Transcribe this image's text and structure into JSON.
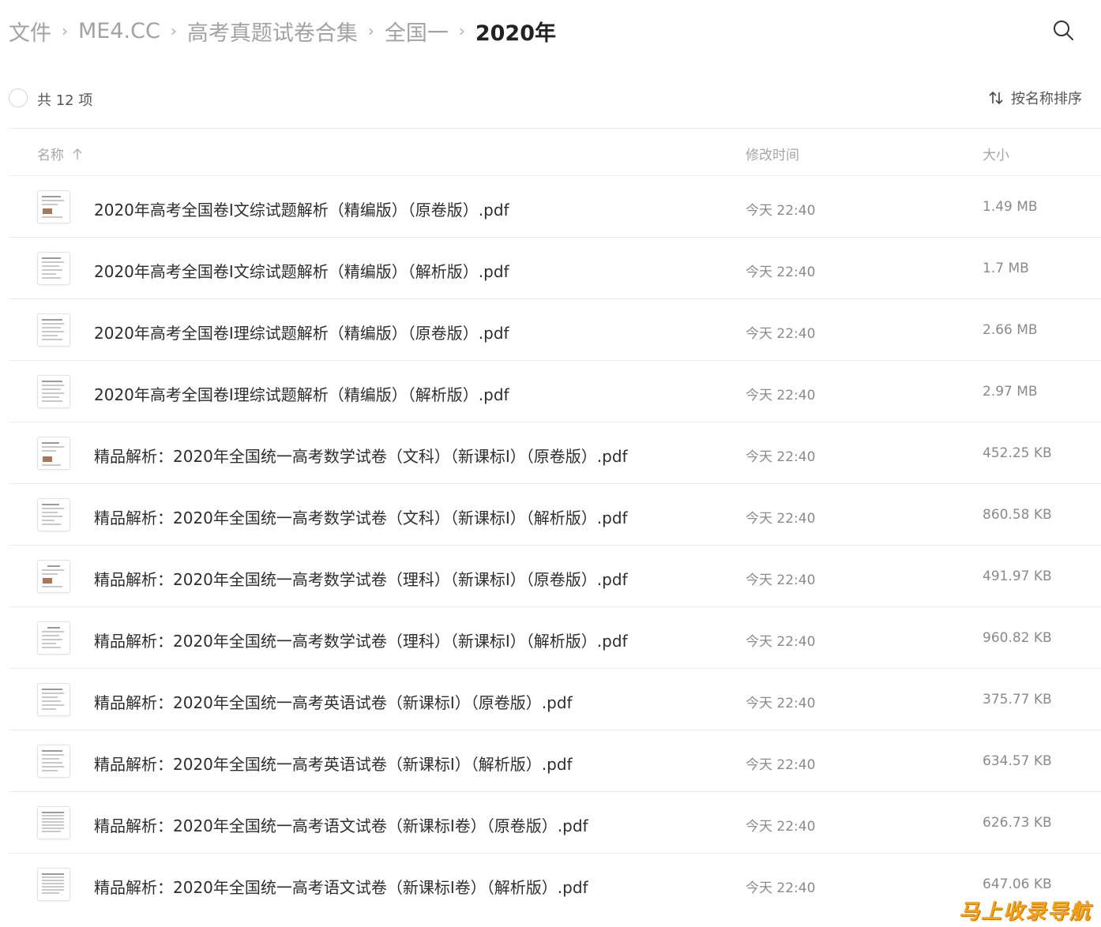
{
  "breadcrumb": {
    "items": [
      "文件",
      "ME4.CC",
      "高考真题试卷合集",
      "全国一",
      "2020年"
    ],
    "separator": "›"
  },
  "toolbar": {
    "count_label": "共 12 项",
    "sort_label": "按名称排序"
  },
  "columns": {
    "name": "名称",
    "mtime": "修改时间",
    "size": "大小"
  },
  "files": [
    {
      "name": "2020年高考全国卷Ⅰ文综试题解析（精编版）（原卷版）.pdf",
      "mtime": "今天 22:40",
      "size": "1.49 MB"
    },
    {
      "name": "2020年高考全国卷Ⅰ文综试题解析（精编版）（解析版）.pdf",
      "mtime": "今天 22:40",
      "size": "1.7 MB"
    },
    {
      "name": "2020年高考全国卷Ⅰ理综试题解析（精编版）（原卷版）.pdf",
      "mtime": "今天 22:40",
      "size": "2.66 MB"
    },
    {
      "name": "2020年高考全国卷Ⅰ理综试题解析（精编版）（解析版）.pdf",
      "mtime": "今天 22:40",
      "size": "2.97 MB"
    },
    {
      "name": "精品解析：2020年全国统一高考数学试卷（文科）（新课标Ⅰ）（原卷版）.pdf",
      "mtime": "今天 22:40",
      "size": "452.25 KB"
    },
    {
      "name": "精品解析：2020年全国统一高考数学试卷（文科）（新课标Ⅰ）（解析版）.pdf",
      "mtime": "今天 22:40",
      "size": "860.58 KB"
    },
    {
      "name": "精品解析：2020年全国统一高考数学试卷（理科）（新课标Ⅰ）（原卷版）.pdf",
      "mtime": "今天 22:40",
      "size": "491.97 KB"
    },
    {
      "name": "精品解析：2020年全国统一高考数学试卷（理科）（新课标Ⅰ）（解析版）.pdf",
      "mtime": "今天 22:40",
      "size": "960.82 KB"
    },
    {
      "name": "精品解析：2020年全国统一高考英语试卷（新课标Ⅰ）（原卷版）.pdf",
      "mtime": "今天 22:40",
      "size": "375.77 KB"
    },
    {
      "name": "精品解析：2020年全国统一高考英语试卷（新课标Ⅰ）（解析版）.pdf",
      "mtime": "今天 22:40",
      "size": "634.57 KB"
    },
    {
      "name": "精品解析：2020年全国统一高考语文试卷（新课标Ⅰ卷）（原卷版）.pdf",
      "mtime": "今天 22:40",
      "size": "626.73 KB"
    },
    {
      "name": "精品解析：2020年全国统一高考语文试卷（新课标Ⅰ卷）（解析版）.pdf",
      "mtime": "今天 22:40",
      "size": "647.06 KB"
    }
  ],
  "icons": {
    "search": "search-icon",
    "sort": "sort-arrows-icon",
    "sort_direction": "arrow-up-icon",
    "file_thumb": "pdf-thumbnail-icon"
  },
  "watermark": "马上收录导航",
  "colors": {
    "crumb_inactive": "#a2a2a2",
    "crumb_active": "#222222",
    "divider": "#ececec",
    "watermark": "#f4a21a"
  }
}
